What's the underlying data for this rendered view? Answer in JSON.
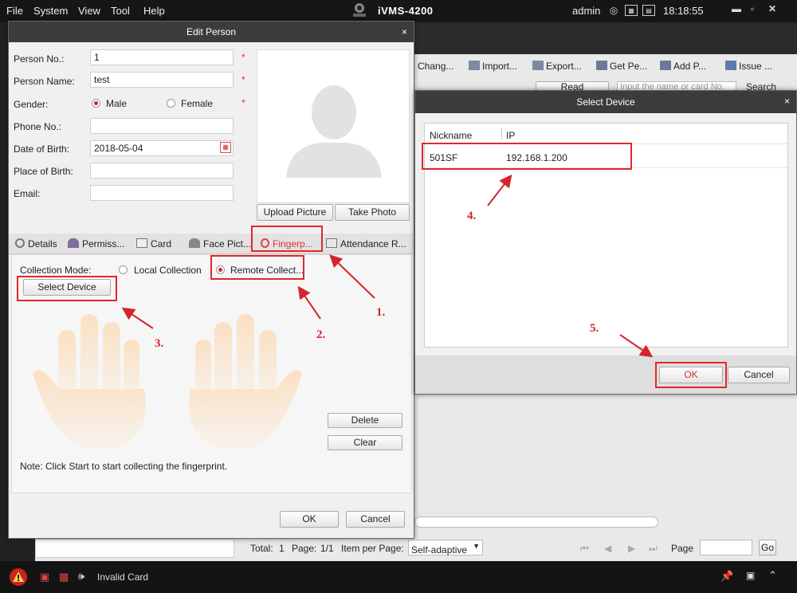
{
  "menu": [
    "File",
    "System",
    "View",
    "Tool",
    "Help"
  ],
  "app_title": "iVMS-4200",
  "user": "admin",
  "clock": "18:18:55",
  "toolbar": [
    "Chang...",
    "Import...",
    "Export...",
    "Get Pe...",
    "Add P...",
    "Issue ..."
  ],
  "search": {
    "read_label": "Read",
    "placeholder": "Input the name or card No.",
    "search_label": "Search"
  },
  "bottom": {
    "total_label": "Total:",
    "total": "1",
    "page_label": "Page:",
    "page": "1/1",
    "per_page_label": "Item per Page:",
    "per_page": "Self-adaptive",
    "goto_label": "Page",
    "go": "Go"
  },
  "status": {
    "invalid_card": "Invalid Card"
  },
  "edit_person": {
    "title": "Edit Person",
    "close": "×",
    "fields": {
      "person_no_label": "Person No.:",
      "person_no": "1",
      "name_label": "Person Name:",
      "name": "test",
      "gender_label": "Gender:",
      "male": "Male",
      "female": "Female",
      "phone_label": "Phone No.:",
      "phone": "",
      "dob_label": "Date of Birth:",
      "dob": "2018-05-04",
      "pob_label": "Place of Birth:",
      "pob": "",
      "email_label": "Email:",
      "email": "",
      "required": "*"
    },
    "upload_picture": "Upload Picture",
    "take_photo": "Take Photo",
    "tabs": [
      "Details",
      "Permiss...",
      "Card",
      "Face Pict...",
      "Fingerp...",
      "Attendance R..."
    ],
    "collection_mode_label": "Collection Mode:",
    "local_collection": "Local Collection",
    "remote_collection": "Remote Collect...",
    "select_device": "Select Device",
    "delete": "Delete",
    "clear": "Clear",
    "note": "Note: Click Start to start collecting the fingerprint.",
    "ok": "OK",
    "cancel": "Cancel"
  },
  "select_device": {
    "title": "Select Device",
    "close": "×",
    "columns": [
      "Nickname",
      "IP"
    ],
    "rows": [
      {
        "nickname": "501SF",
        "ip": "192.168.1.200"
      }
    ],
    "ok": "OK",
    "cancel": "Cancel"
  },
  "annotations": [
    "1.",
    "2.",
    "3.",
    "4.",
    "5."
  ],
  "colors": {
    "accent_red": "#e0282a",
    "title_bar": "#3c3c3c",
    "menubar": "#161616"
  }
}
